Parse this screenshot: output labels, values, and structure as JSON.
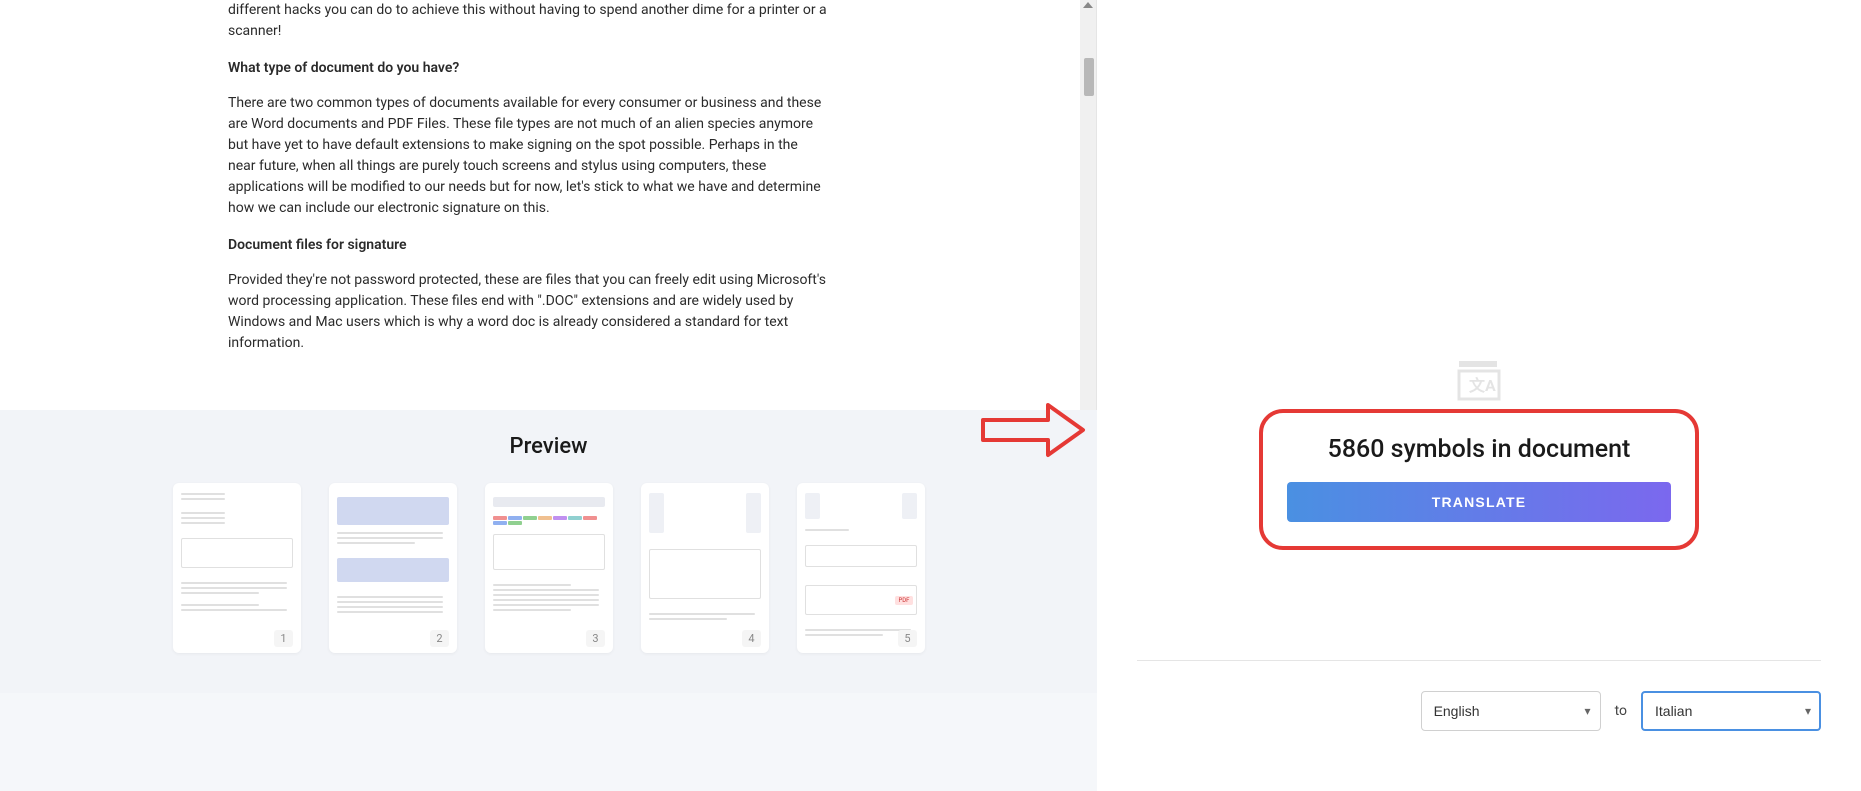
{
  "document": {
    "para_intro_tail": "different hacks you can do to achieve this without having to spend another dime for a printer or a scanner!",
    "heading1": "What type of document do you have?",
    "para1": "There are two common types of documents available for every consumer or business and these are Word documents and PDF Files. These file types are not much of an alien species anymore but have yet to have default extensions to make signing on the spot possible. Perhaps in the near future, when all things are purely touch screens and stylus using computers, these applications will be modified to our needs but for now, let's stick to what we have and determine how we can include our electronic signature on this.",
    "heading2": "Document files for signature",
    "para2": "Provided they're not password protected, these are files that you can freely edit using Microsoft's word processing application. These files end with \".DOC\" extensions and are widely used by Windows and Mac users which is why a word doc is already considered a standard for text information."
  },
  "preview": {
    "title": "Preview",
    "thumbs": [
      "1",
      "2",
      "3",
      "4",
      "5"
    ]
  },
  "translate": {
    "symbols_count": "5860",
    "symbols_label": "symbols in document",
    "button_label": "TRANSLATE"
  },
  "languages": {
    "source": "English",
    "target": "Italian",
    "to_label": "to"
  }
}
